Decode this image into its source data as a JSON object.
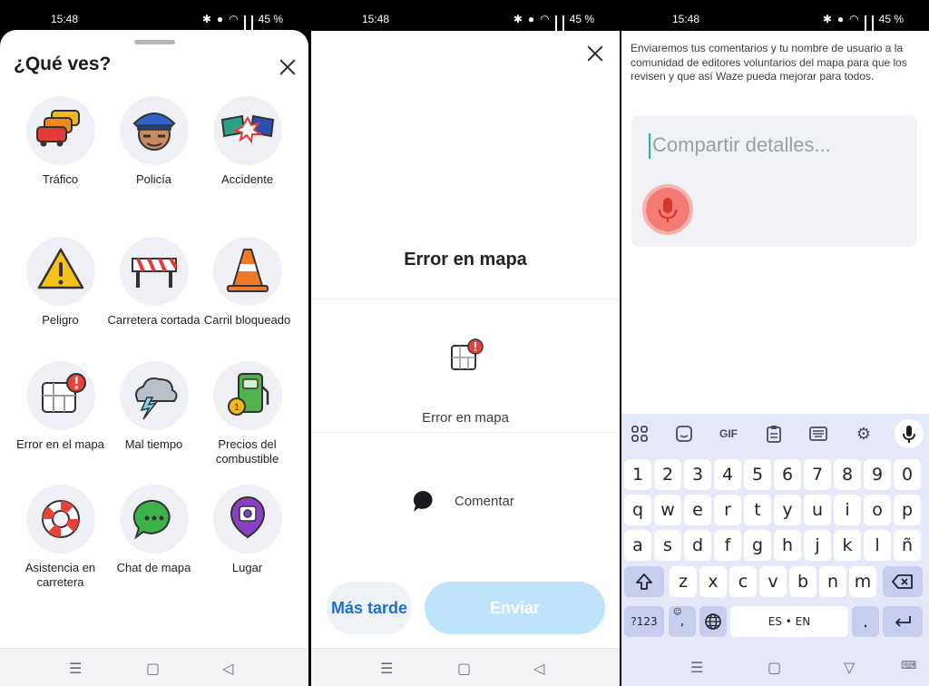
{
  "status": {
    "time": "15:48",
    "battery": "45 %"
  },
  "panel1": {
    "title": "¿Qué ves?",
    "items": [
      {
        "label": "Tráfico",
        "icon": "traffic-cars-icon"
      },
      {
        "label": "Policía",
        "icon": "police-officer-icon"
      },
      {
        "label": "Accidente",
        "icon": "crash-icon"
      },
      {
        "label": "Peligro",
        "icon": "warning-triangle-icon"
      },
      {
        "label": "Carretera cortada",
        "icon": "road-barrier-icon"
      },
      {
        "label": "Carril bloqueado",
        "icon": "traffic-cone-icon"
      },
      {
        "label": "Error en el mapa",
        "icon": "map-error-icon"
      },
      {
        "label": "Mal tiempo",
        "icon": "storm-cloud-icon"
      },
      {
        "label": "Precios del combustible",
        "icon": "fuel-pump-icon"
      },
      {
        "label": "Asistencia en carretera",
        "icon": "lifebuoy-icon"
      },
      {
        "label": "Chat de mapa",
        "icon": "chat-bubble-icon"
      },
      {
        "label": "Lugar",
        "icon": "camera-pin-icon"
      }
    ]
  },
  "panel2": {
    "title": "Error en mapa",
    "subtitle": "Error en mapa",
    "comment": "Comentar",
    "later_label": "Más tarde",
    "send_label": "Enviar"
  },
  "panel3": {
    "info": "Enviaremos tus comentarios y tu nombre de usuario a la comunidad de editores voluntarios del mapa para que los revisen y que así Waze pueda mejorar para todos.",
    "placeholder": "Compartir detalles...",
    "keyboard": {
      "toolbar_gif": "GIF",
      "row_numbers": [
        "1",
        "2",
        "3",
        "4",
        "5",
        "6",
        "7",
        "8",
        "9",
        "0"
      ],
      "row1": [
        "q",
        "w",
        "e",
        "r",
        "t",
        "y",
        "u",
        "i",
        "o",
        "p"
      ],
      "row2": [
        "a",
        "s",
        "d",
        "f",
        "g",
        "h",
        "j",
        "k",
        "l",
        "ñ"
      ],
      "row3": [
        "z",
        "x",
        "c",
        "v",
        "b",
        "n",
        "m"
      ],
      "symbols_label": "?123",
      "comma_label": ",",
      "space_label": "ES • EN",
      "period_label": "."
    }
  },
  "colors": {
    "waze_blue": "#1c6fd4",
    "send_disabled": "#bfe3fb",
    "mic_red": "#f47b73",
    "keyboard_bg": "#e4e8f8"
  }
}
